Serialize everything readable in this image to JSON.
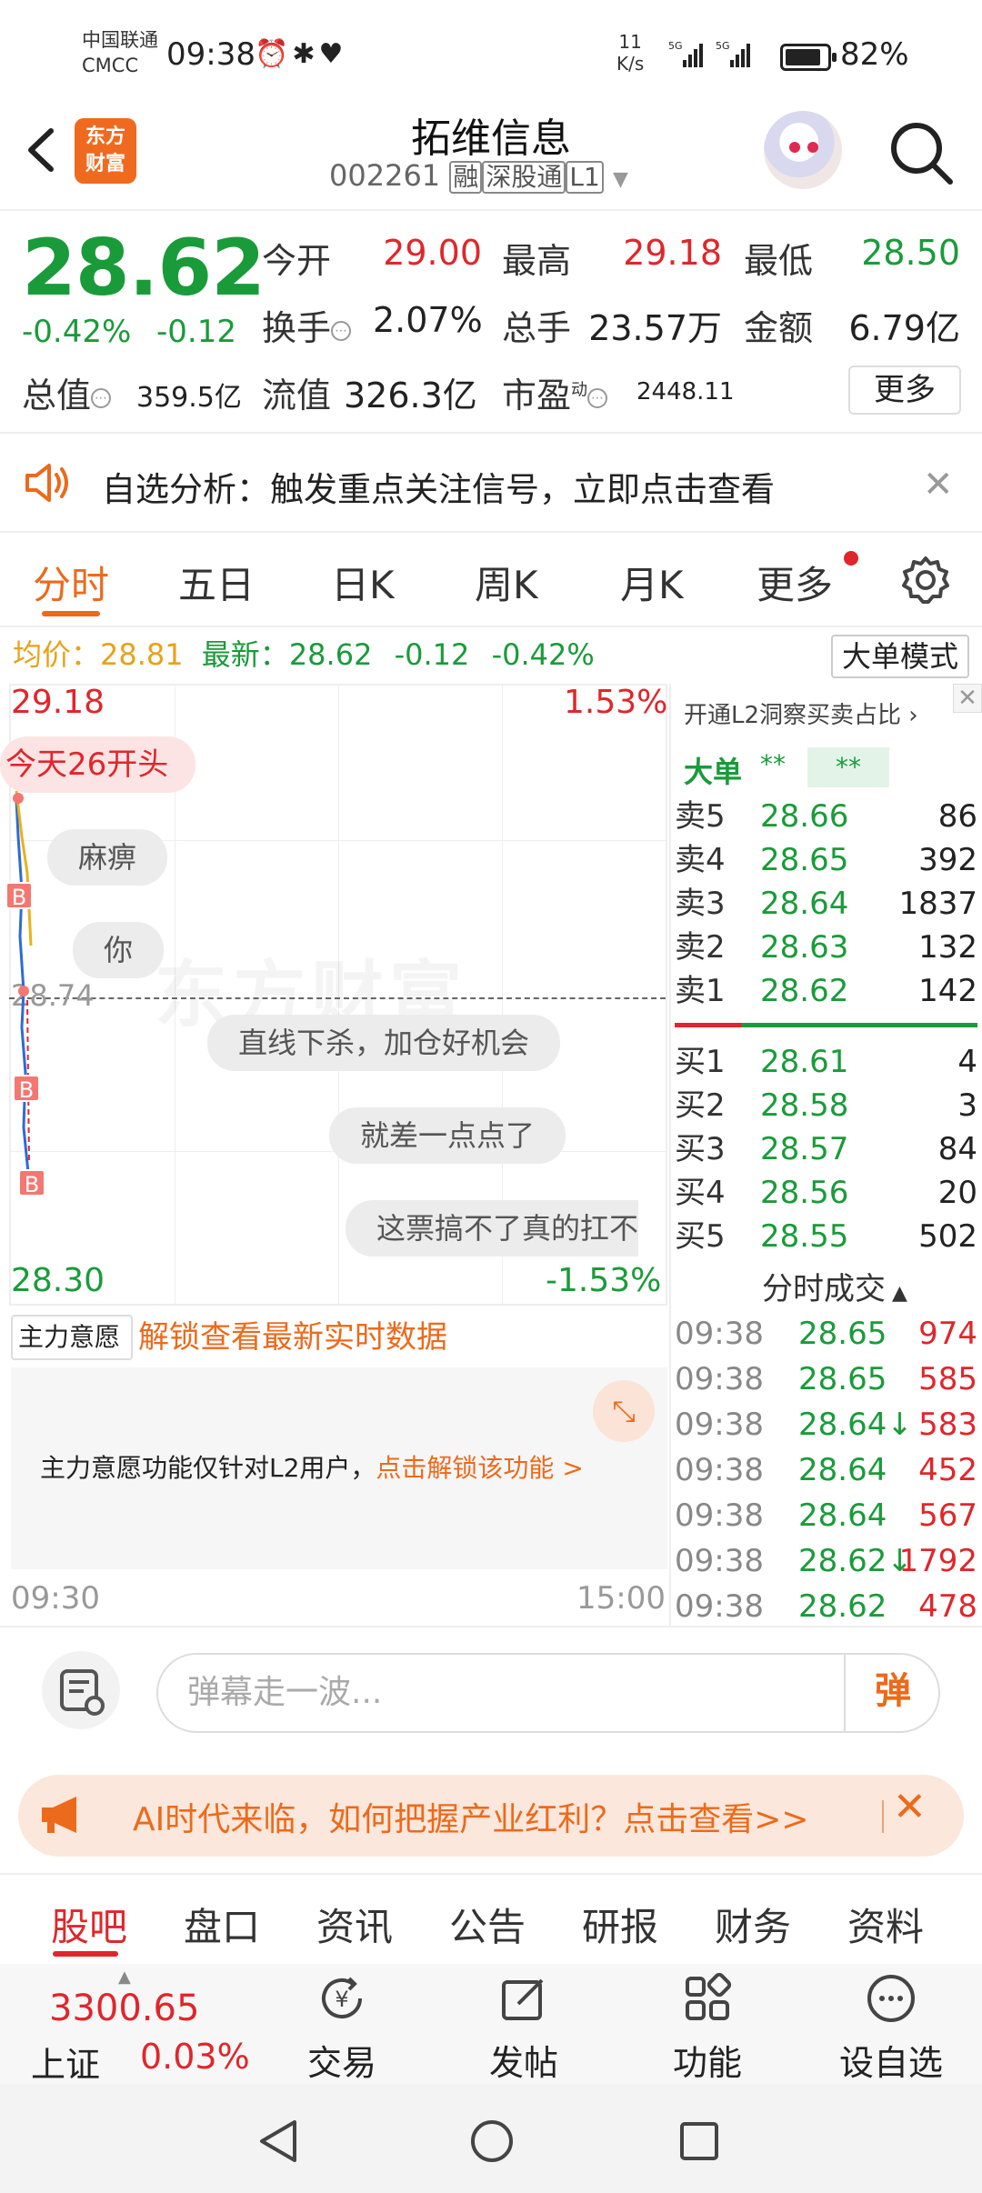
{
  "status_bar": {
    "carrier_line1": "中国联通",
    "carrier_line2": "CMCC",
    "time": "09:38",
    "net_speed_value": "11",
    "net_speed_unit": "K/s",
    "battery": "82%"
  },
  "header": {
    "logo_line1": "东方",
    "logo_line2": "财富",
    "stock_name": "拓维信息",
    "stock_code": "002261",
    "tag_margin": "融",
    "tag_connect": "深股通",
    "tag_level": "L1"
  },
  "quote": {
    "price": "28.62",
    "change_pct": "-0.42%",
    "change_amt": "-0.12",
    "open_label": "今开",
    "open_value": "29.00",
    "high_label": "最高",
    "high_value": "29.18",
    "low_label": "最低",
    "low_value": "28.50",
    "turnover_label": "换手",
    "turnover_value": "2.07%",
    "volume_label": "总手",
    "volume_value": "23.57万",
    "amount_label": "金额",
    "amount_value": "6.79亿",
    "mktcap_label": "总值",
    "mktcap_value": "359.5亿",
    "float_label": "流值",
    "float_value": "326.3亿",
    "pe_label": "市盈",
    "pe_superscript": "动",
    "pe_value": "2448.11",
    "more_button": "更多"
  },
  "notice": {
    "text": "自选分析：触发重点关注信号，立即点击查看"
  },
  "chart_tabs": [
    "分时",
    "五日",
    "日K",
    "周K",
    "月K",
    "更多"
  ],
  "avg_row": {
    "avg_label": "均价：",
    "avg_value": "28.81",
    "latest_label": "最新：",
    "latest_value": "28.62",
    "change_amt": "-0.12",
    "change_pct": "-0.42%",
    "big_order_mode": "大单模式"
  },
  "chart": {
    "high_label": "29.18",
    "high_pct": "1.53%",
    "mid_label": "28.74",
    "low_label": "28.30",
    "low_pct": "-1.53%",
    "watermark": "东方财富",
    "trade_marker": "B",
    "time_start": "09:30",
    "time_end": "15:00"
  },
  "danmu": {
    "red": "今天26开头",
    "d1": "麻痹",
    "d2": "你",
    "d3": "直线下杀，加仓好机会",
    "d4": "就差一点点了",
    "d5": "这票搞不了真的扛不"
  },
  "order_book": {
    "promo": "开通L2洞察买卖占比",
    "big_order_label": "大单",
    "big_order_star1": "**",
    "big_order_star2": "**",
    "asks": [
      {
        "label": "卖5",
        "price": "28.66",
        "volume": "86"
      },
      {
        "label": "卖4",
        "price": "28.65",
        "volume": "392"
      },
      {
        "label": "卖3",
        "price": "28.64",
        "volume": "1837"
      },
      {
        "label": "卖2",
        "price": "28.63",
        "volume": "132"
      },
      {
        "label": "卖1",
        "price": "28.62",
        "volume": "142"
      }
    ],
    "bids": [
      {
        "label": "买1",
        "price": "28.61",
        "volume": "4"
      },
      {
        "label": "买2",
        "price": "28.58",
        "volume": "3"
      },
      {
        "label": "买3",
        "price": "28.57",
        "volume": "84"
      },
      {
        "label": "买4",
        "price": "28.56",
        "volume": "20"
      },
      {
        "label": "买5",
        "price": "28.55",
        "volume": "502"
      }
    ]
  },
  "ticks": {
    "title": "分时成交",
    "rows": [
      {
        "time": "09:38",
        "price": "28.65",
        "volume": "974"
      },
      {
        "time": "09:38",
        "price": "28.65",
        "volume": "585"
      },
      {
        "time": "09:38",
        "price": "28.64↓",
        "volume": "583"
      },
      {
        "time": "09:38",
        "price": "28.64",
        "volume": "452"
      },
      {
        "time": "09:38",
        "price": "28.64",
        "volume": "567"
      },
      {
        "time": "09:38",
        "price": "28.62↓",
        "volume": "1792"
      },
      {
        "time": "09:38",
        "price": "28.62",
        "volume": "478"
      }
    ]
  },
  "main_force": {
    "select_label": "主力意愿",
    "unlock_text": "解锁查看最新实时数据",
    "message": "主力意愿功能仅针对L2用户，",
    "message_link": "点击解锁该功能 >"
  },
  "comment": {
    "placeholder": "弹幕走一波...",
    "send_label": "弹"
  },
  "ai_banner": {
    "text": "AI时代来临，如何把握产业红利？点击查看>>"
  },
  "bottom_tabs": [
    "股吧",
    "盘口",
    "资讯",
    "公告",
    "研报",
    "财务",
    "资料"
  ],
  "toolbar": {
    "index_value": "3300.65",
    "index_name": "上证",
    "index_pct": "0.03%",
    "trade": "交易",
    "post": "发帖",
    "function": "功能",
    "watchlist": "设自选"
  },
  "colors": {
    "up": "#e0262b",
    "down": "#1a9b3a",
    "accent": "#ec6a1c"
  }
}
